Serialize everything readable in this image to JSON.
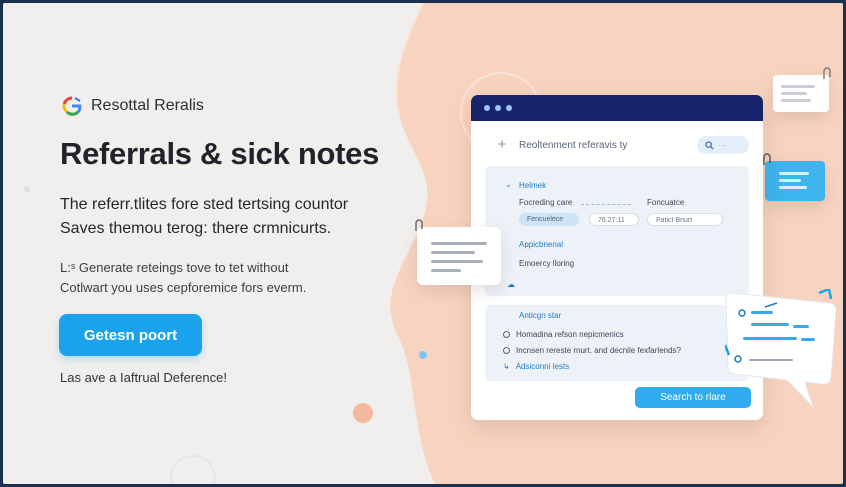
{
  "colors": {
    "frame": "#1b2f4f",
    "canvas": "#f1efed",
    "peach": "#f8d4c0",
    "accent": "#1aa3ec",
    "titlebar": "#17236a",
    "section_blue": "#1e7bc2"
  },
  "brand": {
    "logo_icon": "g-logo-icon",
    "name": "Resottal Reralis"
  },
  "hero": {
    "title": "Referrals & sick notes",
    "subtitle_line1": "The referr.tlites fore sted tertsing countor",
    "subtitle_line2": "Saves themou terog: there crmnicurts.",
    "desc_line1": "L:ˢ Generate reteings tove to tet without",
    "desc_line2": "Cotlwart you uses cepforemice fors everm.",
    "cta_label": "Getesn poort",
    "footnote": "Las ave a Iaftrual Deference!"
  },
  "app": {
    "header_icon": "plus-icon",
    "title": "Reoltenment referavis ty",
    "search_icon": "search-icon",
    "section1": {
      "heading": "Helmek",
      "label1": "Focreding care",
      "label2": "Foncuatce",
      "field1": "Fencuelece",
      "field2": "76.27:11",
      "field3": "Patict Bnurt"
    },
    "section2": {
      "heading": "Appicbnenal",
      "label": "Emoercy lloring"
    },
    "list": {
      "heading": "Anticgn star",
      "item1": "Homadina refson nepicmenics",
      "item2": "Incnsen rereste rnurt. and decnile fexfarlends?",
      "link": "Adsiconni lests"
    },
    "submit_label": "Search to rlare"
  }
}
